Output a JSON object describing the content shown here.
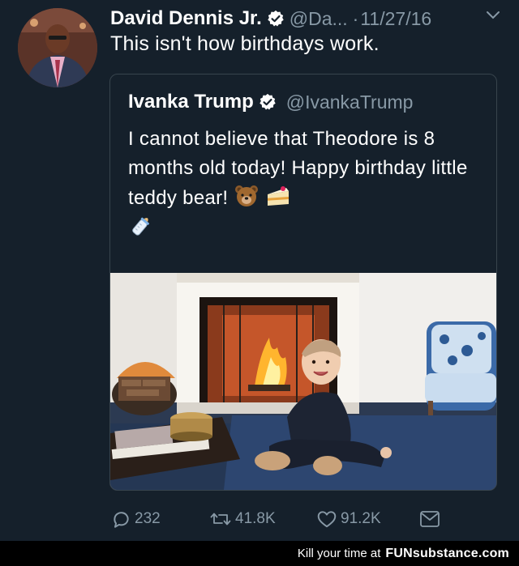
{
  "tweet": {
    "author_name": "David Dennis Jr.",
    "handle": "@Da...",
    "separator": "·",
    "date": "11/27/16",
    "text": "This isn't how birthdays work."
  },
  "quoted_tweet": {
    "author_name": "Ivanka Trump",
    "handle": "@IvankaTrump",
    "text": "I cannot believe that Theodore is 8 months old today! Happy birthday little teddy bear!",
    "emojis": [
      "bear-face-emoji",
      "cake-emoji",
      "baby-bottle-emoji"
    ]
  },
  "actions": {
    "replies": "232",
    "retweets": "41.8K",
    "likes": "91.2K"
  },
  "footer": {
    "prefix": "Kill your time at",
    "brand": "FUNsubstance.com"
  },
  "colors": {
    "background": "#15202b",
    "secondary_text": "#8899a6",
    "verified_badge": "#ffffff",
    "border": "#38444d"
  }
}
